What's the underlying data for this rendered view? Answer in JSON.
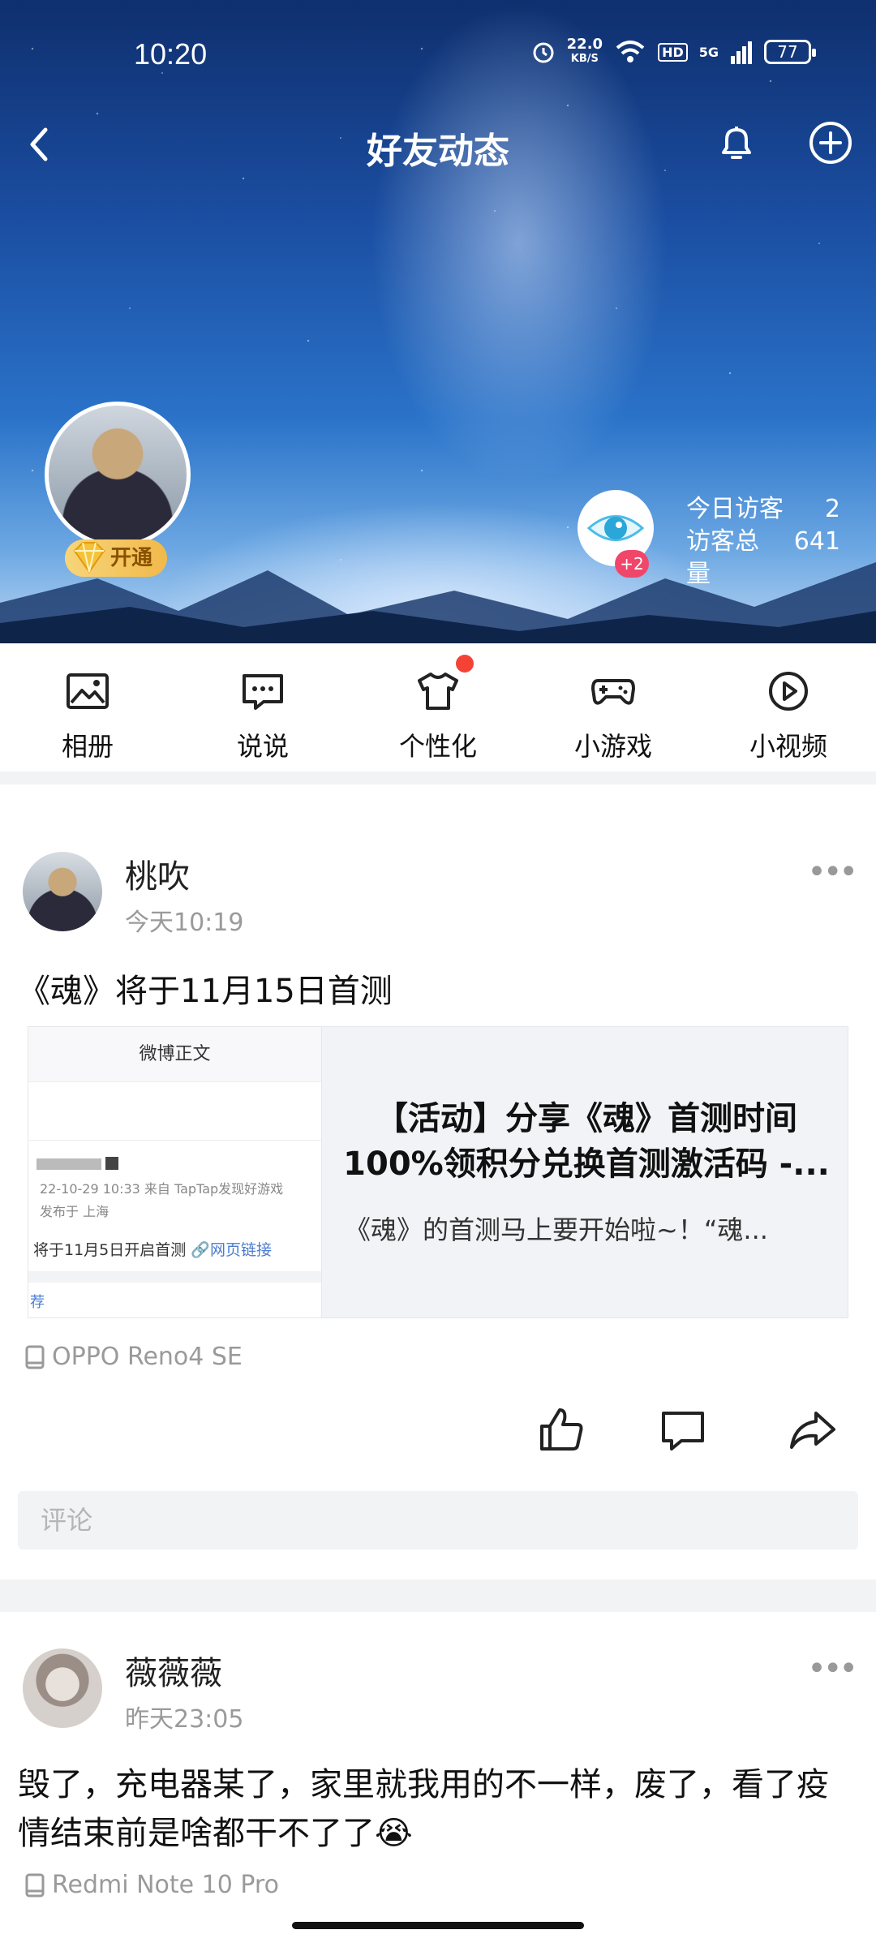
{
  "status_bar": {
    "time": "10:20",
    "net_speed": "22.0",
    "net_unit": "KB/S",
    "hd": "HD",
    "signal": "5G",
    "battery": "77"
  },
  "nav": {
    "title": "好友动态"
  },
  "profile": {
    "vip_label": "开通",
    "visit_badge": "+2",
    "today_label": "今日访客",
    "today_value": "2",
    "total_label": "访客总量",
    "total_value": "641"
  },
  "tabs": [
    {
      "label": "相册",
      "icon": "photo-icon"
    },
    {
      "label": "说说",
      "icon": "chat-bubble-icon"
    },
    {
      "label": "个性化",
      "icon": "shirt-icon"
    },
    {
      "label": "小游戏",
      "icon": "gamepad-icon"
    },
    {
      "label": "小视频",
      "icon": "play-icon"
    }
  ],
  "post1": {
    "name": "桃吹",
    "time": "今天10:19",
    "text": "《魂》将于11月15日首测",
    "card": {
      "thumb_header": "微博正文",
      "thumb_meta1": "22-10-29 10:33  来自 TapTap发现好游戏",
      "thumb_meta2": "发布于 上海",
      "thumb_body": "将于11月5日开启首测",
      "thumb_link": "🔗网页链接",
      "thumb_tag": "荐",
      "title": "【活动】分享《魂》首测时间100%领积分兑换首测激活码 -...",
      "desc": "《魂》的首测马上要开始啦~！“魂..."
    },
    "device": "OPPO Reno4 SE",
    "comment_placeholder": "评论"
  },
  "post2": {
    "name": "薇薇薇",
    "time": "昨天23:05",
    "text": "毁了，充电器某了，家里就我用的不一样，废了，看了疫情结束前是啥都干不了了😭",
    "device": "Redmi Note 10 Pro"
  }
}
